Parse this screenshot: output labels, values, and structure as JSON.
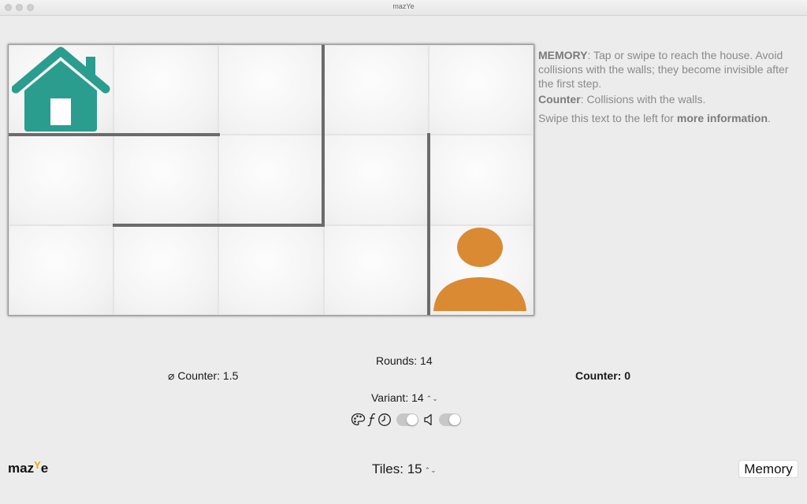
{
  "window": {
    "title": "mazYe"
  },
  "board": {
    "cols": 5,
    "rows": 3,
    "home_icon": "house-icon",
    "player_icon": "person-icon",
    "colors": {
      "home": "#2a9d8f",
      "player": "#d98a32",
      "wall": "#6b6b6b"
    }
  },
  "info": {
    "mode_name": "MEMORY",
    "mode_text": ": Tap or swipe to reach the house. Avoid collisions with the walls; they become invisible after the first step.",
    "counter_name": "Counter",
    "counter_text": ": Collisions with the walls.",
    "swipe_text": "Swipe this text to the left for ",
    "swipe_bold": "more information",
    "swipe_end": "."
  },
  "stats": {
    "rounds": "Rounds: 14",
    "avg_counter": "⌀ Counter: 1.5",
    "counter": "Counter: 0",
    "variant": "Variant: 14",
    "tiles": "Tiles: 15"
  },
  "controls": {
    "icons": [
      "palette-icon",
      "function-icon",
      "clock-icon",
      "speaker-icon"
    ],
    "stepper_symbol": "⌃⌄"
  },
  "footer": {
    "logo_a": "maz",
    "logo_y": "Y",
    "logo_b": "e",
    "mode_button": "Memory"
  }
}
